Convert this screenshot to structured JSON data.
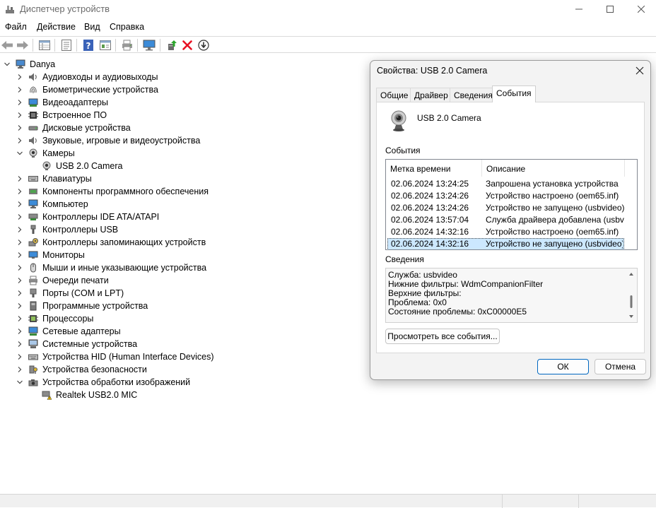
{
  "window": {
    "title": "Диспетчер устройств"
  },
  "menu": [
    "Файл",
    "Действие",
    "Вид",
    "Справка"
  ],
  "toolbar_icons": [
    "back-icon",
    "forward-icon",
    "properties-grid-icon",
    "list-view-icon",
    "help-icon",
    "details-view-icon",
    "print-icon",
    "computer-monitor-icon",
    "update-driver-icon",
    "uninstall-icon",
    "download-icon"
  ],
  "tree": {
    "root": "Danya",
    "categories": [
      {
        "label": "Аудиовходы и аудиовыходы",
        "icon": "speaker-icon"
      },
      {
        "label": "Биометрические устройства",
        "icon": "fingerprint-icon"
      },
      {
        "label": "Видеоадаптеры",
        "icon": "display-adapter-icon"
      },
      {
        "label": "Встроенное ПО",
        "icon": "firmware-icon"
      },
      {
        "label": "Дисковые устройства",
        "icon": "disk-icon"
      },
      {
        "label": "Звуковые, игровые и видеоустройства",
        "icon": "sound-icon"
      },
      {
        "label": "Камеры",
        "icon": "camera-icon"
      },
      {
        "label": "USB 2.0 Camera",
        "icon": "webcam-icon"
      },
      {
        "label": "Клавиатуры",
        "icon": "keyboard-icon"
      },
      {
        "label": "Компоненты программного обеспечения",
        "icon": "software-component-icon"
      },
      {
        "label": "Компьютер",
        "icon": "computer-icon"
      },
      {
        "label": "Контроллеры IDE ATA/ATAPI",
        "icon": "ide-controller-icon"
      },
      {
        "label": "Контроллеры USB",
        "icon": "usb-icon"
      },
      {
        "label": "Контроллеры запоминающих устройств",
        "icon": "storage-controller-icon"
      },
      {
        "label": "Мониторы",
        "icon": "monitor-icon"
      },
      {
        "label": "Мыши и иные указывающие устройства",
        "icon": "mouse-icon"
      },
      {
        "label": "Очереди печати",
        "icon": "print-queue-icon"
      },
      {
        "label": "Порты (COM и LPT)",
        "icon": "port-icon"
      },
      {
        "label": "Программные устройства",
        "icon": "software-device-icon"
      },
      {
        "label": "Процессоры",
        "icon": "processor-icon"
      },
      {
        "label": "Сетевые адаптеры",
        "icon": "network-adapter-icon"
      },
      {
        "label": "Системные устройства",
        "icon": "system-device-icon"
      },
      {
        "label": "Устройства HID (Human Interface Devices)",
        "icon": "hid-icon"
      },
      {
        "label": "Устройства безопасности",
        "icon": "security-device-icon"
      },
      {
        "label": "Устройства обработки изображений",
        "icon": "imaging-device-icon"
      },
      {
        "label": "Realtek USB2.0 MIC",
        "icon": "warning-device-icon"
      }
    ]
  },
  "dialog": {
    "title": "Свойства: USB 2.0 Camera",
    "tabs": [
      "Общие",
      "Драйвер",
      "Сведения",
      "События"
    ],
    "active_tab": "События",
    "device_name": "USB 2.0 Camera",
    "events_label": "События",
    "columns": [
      "Метка времени",
      "Описание"
    ],
    "events": [
      {
        "time": "02.06.2024 13:24:25",
        "desc": "Запрошена установка устройства"
      },
      {
        "time": "02.06.2024 13:24:26",
        "desc": "Устройство настроено (oem65.inf)"
      },
      {
        "time": "02.06.2024 13:24:26",
        "desc": "Устройство не запущено (usbvideo)"
      },
      {
        "time": "02.06.2024 13:57:04",
        "desc": "Служба драйвера добавлена (usbvi..."
      },
      {
        "time": "02.06.2024 14:32:16",
        "desc": "Устройство настроено (oem65.inf)"
      },
      {
        "time": "02.06.2024 14:32:16",
        "desc": "Устройство не запущено (usbvideo)"
      }
    ],
    "selected_event_index": 5,
    "details_label": "Сведения",
    "details": [
      "Служба: usbvideo",
      "Нижние фильтры: WdmCompanionFilter",
      "Верхние фильтры:",
      "Проблема: 0x0",
      "Состояние проблемы: 0xC00000E5"
    ],
    "view_all_button": "Просмотреть все события...",
    "ok_button": "ОК",
    "cancel_button": "Отмена"
  },
  "colors": {
    "accent": "#0067c0",
    "selection": "#cce8ff",
    "error_red": "#e81123",
    "warning_yellow": "#f2c200"
  }
}
